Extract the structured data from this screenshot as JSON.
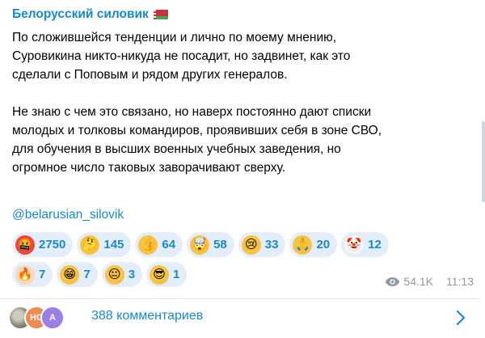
{
  "post": {
    "channel_name": "Белорусский силовик",
    "flag_icon": "belarus-flag-icon",
    "paragraphs": [
      [
        "По сложившейся тенденции и лично по моему мнению,",
        "Суровикина никто-никуда не посадит, но задвинет, как это",
        "сделали с Поповым и рядом других генералов."
      ],
      [
        "Не знаю с чем это связано, но наверх постоянно дают списки",
        "молодых и толковы командиров, проявивших себя в зоне СВО,",
        "для обучения в высших военных учебных заведения, но",
        "огромное число таковых заворачивают сверху."
      ]
    ],
    "mention": "@belarusian_silovik",
    "reactions": [
      {
        "emoji": "🤬",
        "icon": "cursing-face-icon",
        "bg": "#e94a3f",
        "count": "2750"
      },
      {
        "emoji": "🤔",
        "icon": "thinking-face-icon",
        "bg": "#f6c342",
        "count": "145"
      },
      {
        "emoji": "👍",
        "icon": "thumbs-up-icon",
        "bg": "#f6c342",
        "count": "64"
      },
      {
        "emoji": "🤯",
        "icon": "exploding-head-icon",
        "bg": "#f6c342",
        "count": "58"
      },
      {
        "emoji": "😢",
        "icon": "crying-face-icon",
        "bg": "#f6c342",
        "count": "33"
      },
      {
        "emoji": "🙏",
        "icon": "folded-hands-icon",
        "bg": "#f6c342",
        "count": "20"
      },
      {
        "emoji": "🤡",
        "icon": "clown-face-icon",
        "bg": "#f4f4f4",
        "count": "12"
      },
      {
        "emoji": "🔥",
        "icon": "fire-icon",
        "bg": "#fbd9b8",
        "count": "7"
      },
      {
        "emoji": "😁",
        "icon": "grinning-face-icon",
        "bg": "#f6c342",
        "count": "7"
      },
      {
        "emoji": "😐",
        "icon": "neutral-face-icon",
        "bg": "#f6c342",
        "count": "3"
      },
      {
        "emoji": "😎",
        "icon": "sunglasses-face-icon",
        "bg": "#f6c342",
        "count": "1"
      }
    ],
    "views": "54.1K",
    "time": "11:13"
  },
  "comments": {
    "avatars": [
      {
        "label": "",
        "icon": "photo-avatar"
      },
      {
        "label": "НС",
        "icon": "initials-avatar"
      },
      {
        "label": "A",
        "icon": "initials-avatar"
      }
    ],
    "label": "388 комментариев"
  },
  "colors": {
    "accent": "#168acd",
    "meta": "#8a9aa9",
    "reaction_bg": "#e4eefa"
  }
}
